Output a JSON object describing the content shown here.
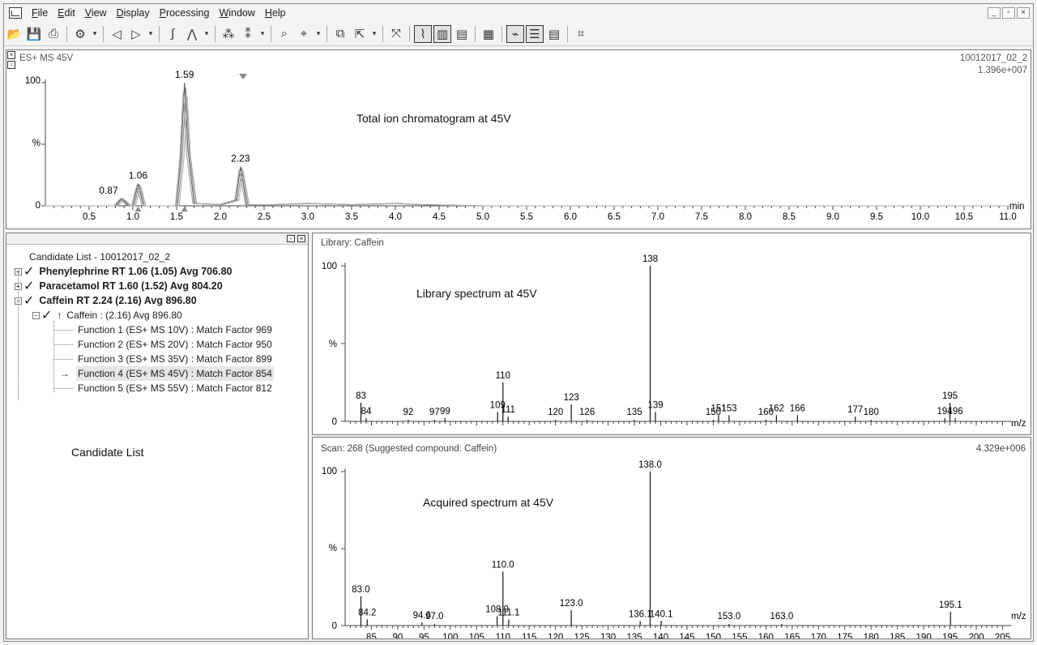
{
  "menu": [
    "File",
    "Edit",
    "View",
    "Display",
    "Processing",
    "Window",
    "Help"
  ],
  "window_controls": [
    "_",
    "▫",
    "×"
  ],
  "tic": {
    "header_left": "ES+ MS  45V",
    "header_right_1": "10012017_02_2",
    "header_right_2": "1.396e+007",
    "annotation": "Total ion chromatogram at 45V",
    "y_labels": [
      "100",
      "%",
      "0"
    ],
    "x_unit": "min",
    "x_ticks": [
      "0.5",
      "1.0",
      "1.5",
      "2.0",
      "2.5",
      "3.0",
      "3.5",
      "4.0",
      "4.5",
      "5.0",
      "5.5",
      "6.0",
      "6.5",
      "7.0",
      "7.5",
      "8.0",
      "8.5",
      "9.0",
      "9.5",
      "10.0",
      "10.5",
      "11.0"
    ],
    "peak_labels": [
      "0.87",
      "1.06",
      "1.59",
      "2.23"
    ]
  },
  "candidate": {
    "title": "Candidate List - 10012017_02_2",
    "annotation": "Candidate List",
    "items": [
      "Phenylephrine RT 1.06 (1.05) Avg 706.80",
      "Paracetamol RT 1.60 (1.52) Avg 804.20",
      "Caffein RT 2.24 (2.16) Avg 896.80"
    ],
    "sub_item": "Caffein : (2.16) Avg 896.80",
    "functions": [
      "Function 1 (ES+ MS  10V) : Match Factor 969",
      "Function 2 (ES+ MS  20V) : Match Factor 950",
      "Function 3 (ES+ MS  35V) : Match Factor 899",
      "Function 4 (ES+ MS  45V) : Match Factor 854",
      "Function 5 (ES+ MS  55V) : Match Factor 812"
    ]
  },
  "library": {
    "header": "Library: Caffein",
    "annotation": "Library spectrum at 45V",
    "y_labels": [
      "100",
      "%",
      "0"
    ],
    "x_unit": "m/z"
  },
  "scan": {
    "header": "Scan: 268 (Suggested compound: Caffein)",
    "header_right": "4.329e+006",
    "annotation": "Acquired spectrum at 45V",
    "y_labels": [
      "100",
      "%",
      "0"
    ],
    "x_unit": "m/z",
    "x_ticks": [
      "85",
      "90",
      "95",
      "100",
      "105",
      "110",
      "115",
      "120",
      "125",
      "130",
      "135",
      "140",
      "145",
      "150",
      "155",
      "160",
      "165",
      "170",
      "175",
      "180",
      "185",
      "190",
      "195",
      "200",
      "205"
    ]
  },
  "chart_data": [
    {
      "type": "line",
      "title": "ES+ MS  45V",
      "xlabel": "min",
      "ylabel": "%",
      "xlim": [
        0,
        11.0
      ],
      "ylim": [
        0,
        100
      ],
      "x": [
        0.0,
        0.5,
        0.8,
        0.87,
        0.95,
        1.0,
        1.06,
        1.12,
        1.5,
        1.55,
        1.59,
        1.63,
        1.7,
        2.0,
        2.18,
        2.23,
        2.3,
        2.6,
        3.0,
        3.5,
        4.0,
        4.3,
        5.0,
        6.0,
        7.0,
        8.0,
        9.0,
        10.0,
        11.0
      ],
      "y": [
        0,
        0,
        0,
        6,
        0,
        0,
        18,
        0,
        0,
        40,
        100,
        45,
        2,
        1,
        5,
        32,
        1,
        1,
        2,
        1,
        2,
        1,
        0,
        0,
        0,
        0,
        0,
        0,
        0
      ],
      "peaks": [
        {
          "x": 0.87,
          "label": "0.87"
        },
        {
          "x": 1.06,
          "label": "1.06"
        },
        {
          "x": 1.59,
          "label": "1.59"
        },
        {
          "x": 2.23,
          "label": "2.23"
        }
      ]
    },
    {
      "type": "bar",
      "title": "Library: Caffein",
      "xlabel": "m/z",
      "ylabel": "%",
      "xlim": [
        80,
        206
      ],
      "ylim": [
        0,
        100
      ],
      "x": [
        83,
        84,
        92,
        97,
        99,
        109,
        110,
        111,
        120,
        123,
        126,
        135,
        138,
        139,
        150,
        151,
        153,
        160,
        162,
        166,
        177,
        180,
        194,
        195,
        196
      ],
      "values": [
        12,
        2,
        1,
        1,
        2,
        6,
        25,
        3,
        1,
        11,
        1,
        1,
        100,
        6,
        1,
        4,
        4,
        1,
        4,
        4,
        3,
        1,
        2,
        12,
        2
      ],
      "labels": [
        "83",
        "84",
        "92",
        "97",
        "99",
        "109",
        "110",
        "111",
        "120",
        "123",
        "126",
        "135",
        "138",
        "139",
        "150",
        "151",
        "153",
        "160",
        "162",
        "166",
        "177",
        "180",
        "194",
        "195",
        "196"
      ]
    },
    {
      "type": "bar",
      "title": "Scan: 268 (Suggested compound: Caffein)",
      "xlabel": "m/z",
      "ylabel": "%",
      "xlim": [
        80,
        206
      ],
      "ylim": [
        0,
        100
      ],
      "x": [
        83.0,
        84.2,
        94.6,
        97.0,
        108.9,
        110.0,
        111.1,
        123.0,
        136.1,
        138.0,
        140.1,
        153.0,
        163.0,
        195.1
      ],
      "values": [
        19,
        4,
        2,
        1,
        6,
        35,
        4,
        10,
        3,
        100,
        3,
        1,
        1,
        9
      ],
      "labels": [
        "83.0",
        "84.2",
        "94.6",
        "97.0",
        "108.9",
        "110.0",
        "111.1",
        "123.0",
        "136.1",
        "138.0",
        "140.1",
        "153.0",
        "163.0",
        "195.1"
      ]
    }
  ]
}
